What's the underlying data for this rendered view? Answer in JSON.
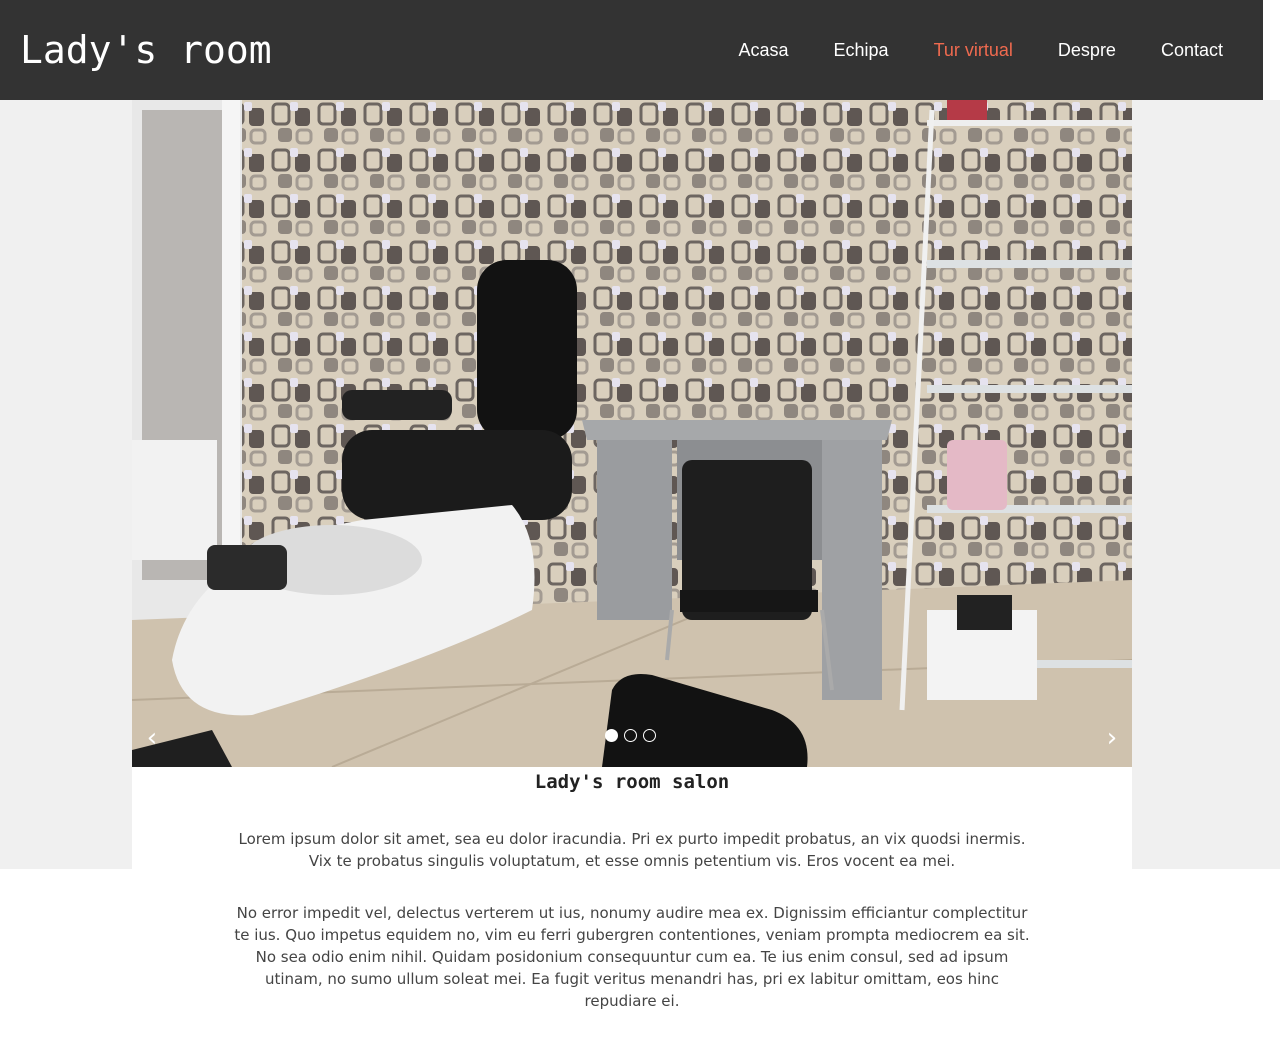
{
  "header": {
    "logo": "Lady's room",
    "nav": [
      {
        "label": "Acasa",
        "active": false
      },
      {
        "label": "Echipa",
        "active": false
      },
      {
        "label": "Tur virtual",
        "active": true
      },
      {
        "label": "Despre",
        "active": false
      },
      {
        "label": "Contact",
        "active": false
      }
    ],
    "accent_color": "#ef6a4f",
    "background_color": "#333333"
  },
  "slider": {
    "image_description_icon": "salon-photo",
    "prev_icon": "chevron-left-icon",
    "prev_glyph": "‹",
    "next_icon": "chevron-right-icon",
    "next_glyph": "›",
    "slides_total": 3,
    "active_slide": 1
  },
  "main": {
    "title": "Lady's room salon",
    "paragraphs": [
      "Lorem ipsum dolor sit amet, sea eu dolor iracundia. Pri ex purto impedit probatus, an vix quodsi inermis. Vix te probatus singulis voluptatum, et esse omnis petentium vis. Eros vocent ea mei.",
      "No error impedit vel, delectus verterem ut ius, nonumy audire mea ex. Dignissim efficiantur complectitur te ius. Quo impetus equidem no, vim eu ferri gubergren contentiones, veniam prompta mediocrem ea sit. No sea odio enim nihil. Quidam posidonium consequuntur cum ea. Te ius enim consul, sed ad ipsum utinam, no sumo ullum soleat mei. Ea fugit veritus menandri has, pri ex labitur omittam, eos hinc repudiare ei."
    ]
  }
}
